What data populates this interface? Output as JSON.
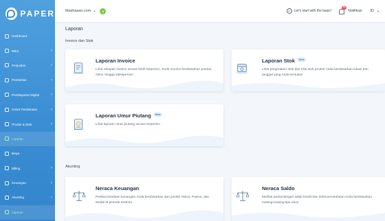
{
  "brand": {
    "name": "PAPER"
  },
  "sidebar": {
    "items": [
      {
        "label": "Dashboard",
        "chevron": ""
      },
      {
        "label": "Mitra",
        "chevron": "›"
      },
      {
        "label": "Penjualan",
        "chevron": "›"
      },
      {
        "label": "Pembelian",
        "chevron": "›"
      },
      {
        "label": "Pembayaran Digital",
        "chevron": "›"
      },
      {
        "label": "Solusi Pendanaan",
        "chevron": "›"
      },
      {
        "label": "Produk & Stok",
        "chevron": "›"
      },
      {
        "label": "Laporan",
        "chevron": ""
      },
      {
        "label": "Biaya",
        "chevron": ""
      },
      {
        "label": "Billing",
        "chevron": "›"
      },
      {
        "label": "Keuangan",
        "chevron": "›"
      },
      {
        "label": "Akunting",
        "chevron": "›"
      },
      {
        "label": "Laporan",
        "chevron": ""
      }
    ]
  },
  "topbar": {
    "company": "Mashasan.com",
    "company_caret": "▼",
    "badge": "$",
    "start_text": "Let's start with the basic!",
    "notif_count": "99",
    "notif_text": "Notifikasi",
    "lang": "ID",
    "lang_caret": "▼"
  },
  "main": {
    "title": "Laporan",
    "section_invoice": "Invoice dan Stok",
    "section_akunting": "Akunting",
    "cards": [
      {
        "title": "Laporan Invoice",
        "badge": "",
        "desc": "Lihat rekapan invoice secara lebih terperinci. Sortir invoice berdasarkan produk, mitra, hingga salesperson"
      },
      {
        "title": "Laporan Stok",
        "badge": "New",
        "desc": "Lihat pergerakan stok dan nilai stok produk Anda berdasarkan lokasi dan tanggal yang Anda tentukan"
      },
      {
        "title": "Laporan Umur Piutang",
        "badge": "New",
        "desc": "Lihat laporan umur piutang secara terperinci"
      },
      {
        "title": "Neraca Keuangan",
        "badge": "",
        "desc": "Periksa keadaan keuangan Anda berdasarkan dari jumlah Aktiva, Pasiva, dan Modal di periode tertentu"
      },
      {
        "title": "Neraca Saldo",
        "badge": "",
        "desc": "Melihat perbandingan saldo kredit dan debit perusahaan Anda berdasarkan masing-masing tipe akun"
      }
    ]
  },
  "colors": {
    "sidebar": "#3b8ed3",
    "active": "#aef0c8",
    "badge_bg": "#dbe9f7",
    "accent": "#3b8ed3"
  }
}
